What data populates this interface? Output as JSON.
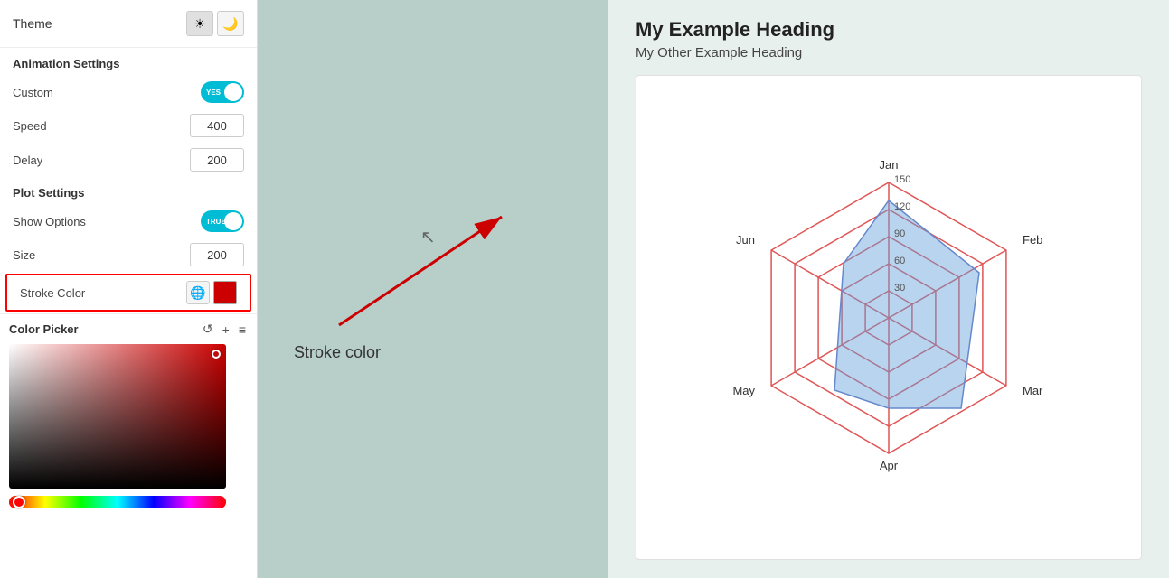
{
  "theme": {
    "label": "Theme",
    "light_icon": "☀",
    "dark_icon": "🌙"
  },
  "animation_settings": {
    "title": "Animation Settings",
    "custom": {
      "label": "Custom",
      "value": "YES",
      "enabled": true
    },
    "speed": {
      "label": "Speed",
      "value": "400"
    },
    "delay": {
      "label": "Delay",
      "value": "200"
    }
  },
  "plot_settings": {
    "title": "Plot Settings",
    "show_options": {
      "label": "Show Options",
      "value": "TRUE",
      "enabled": true
    },
    "size": {
      "label": "Size",
      "value": "200"
    },
    "stroke_color": {
      "label": "Stroke Color"
    }
  },
  "color_picker": {
    "title": "Color Picker",
    "undo_icon": "↺",
    "add_icon": "+",
    "menu_icon": "≡"
  },
  "annotation": {
    "label": "Stroke color"
  },
  "chart": {
    "heading": "My Example Heading",
    "subheading": "My Other Example Heading",
    "labels": {
      "top": "Jan",
      "top_right": "Feb",
      "bottom_right": "Mar",
      "bottom": "Apr",
      "bottom_left": "May",
      "top_left": "Jun"
    },
    "grid_values": [
      "150",
      "120",
      "90",
      "60",
      "30"
    ]
  }
}
